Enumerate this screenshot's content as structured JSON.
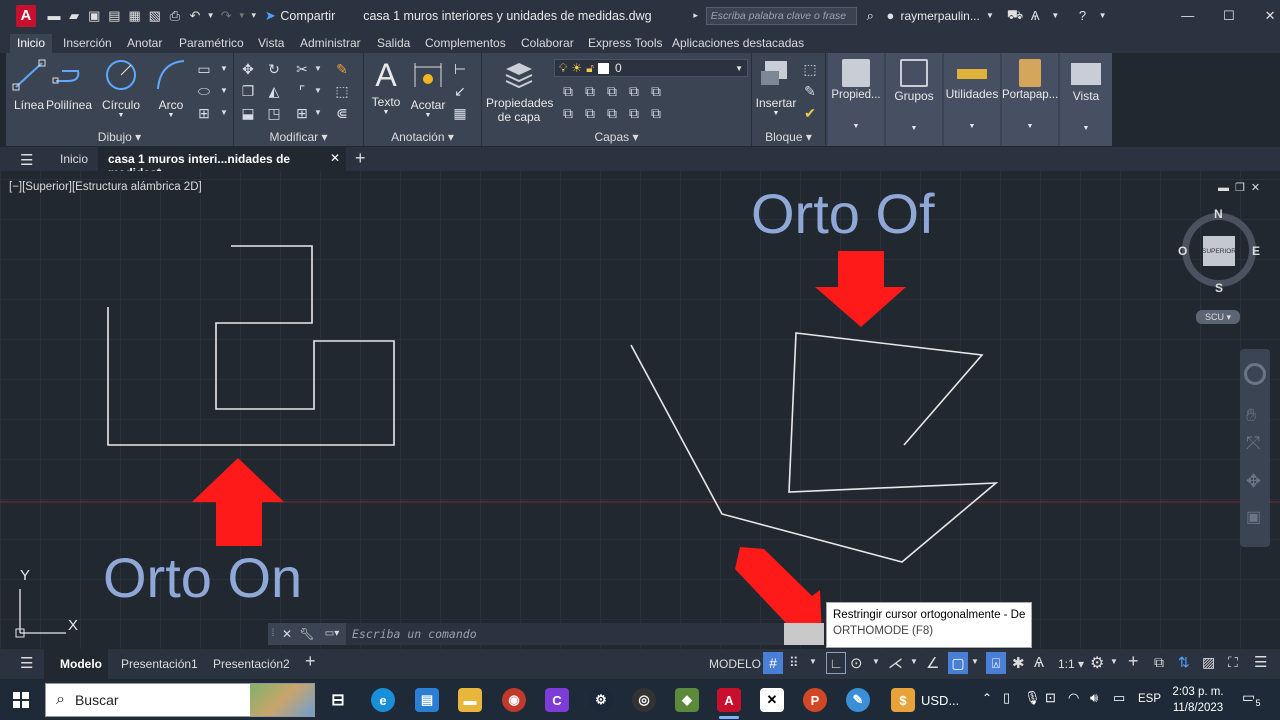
{
  "titlebar": {
    "app_logo": "A",
    "share": "Compartir",
    "document_title": "casa 1 muros interiores y unidades de medidas.dwg",
    "search_placeholder": "Escriba palabra clave o frase",
    "user": "raymerpaulin..."
  },
  "ribbon_tabs": [
    "Inicio",
    "Inserción",
    "Anotar",
    "Paramétrico",
    "Vista",
    "Administrar",
    "Salida",
    "Complementos",
    "Colaborar",
    "Express Tools",
    "Aplicaciones destacadas"
  ],
  "ribbon": {
    "dibujo": {
      "title": "Dibujo",
      "linea": "Línea",
      "polilinea": "Polilínea",
      "circulo": "Círculo",
      "arco": "Arco"
    },
    "modificar": {
      "title": "Modificar"
    },
    "anotacion": {
      "title": "Anotación",
      "texto": "Texto",
      "acotar": "Acotar"
    },
    "capas": {
      "title": "Capas",
      "propiedades_1": "Propiedades",
      "propiedades_2": "de capa",
      "layer_value": "0"
    },
    "bloque": {
      "title": "Bloque",
      "insertar": "Insertar"
    },
    "propiedades": "Propied...",
    "grupos": "Grupos",
    "utilidades": "Utilidades",
    "portapapeles": "Portapap...",
    "vista": "Vista"
  },
  "doc_tabs": {
    "home": "Inicio",
    "current": "casa 1 muros interi...nidades de medidas*"
  },
  "viewport": {
    "label": "[−][Superior][Estructura alámbrica 2D]",
    "viewcube": {
      "n": "N",
      "s": "S",
      "e": "E",
      "o": "O",
      "face": "SUPERIOR",
      "ucs": "SCU"
    },
    "ucs_axis": {
      "x": "X",
      "y": "Y"
    },
    "annotation_on": "Orto On",
    "annotation_off": "Orto Of",
    "command_placeholder": "Escriba un comando",
    "tooltip_title": "Restringir cursor ortogonalmente - Des",
    "tooltip_cmd": "ORTHOMODE (F8)"
  },
  "layout_tabs": [
    "Modelo",
    "Presentación1",
    "Presentación2"
  ],
  "status": {
    "modelo": "MODELO",
    "scale": "1:1"
  },
  "taskbar": {
    "search": "Buscar",
    "usd": "USD...",
    "lang": "ESP",
    "time": "2:03 p. m.",
    "date": "11/8/2023",
    "notif": "5"
  },
  "colors": {
    "accent": "#c8102e",
    "arrow": "#ff1a1a",
    "annotation": "#8fa8d8"
  }
}
